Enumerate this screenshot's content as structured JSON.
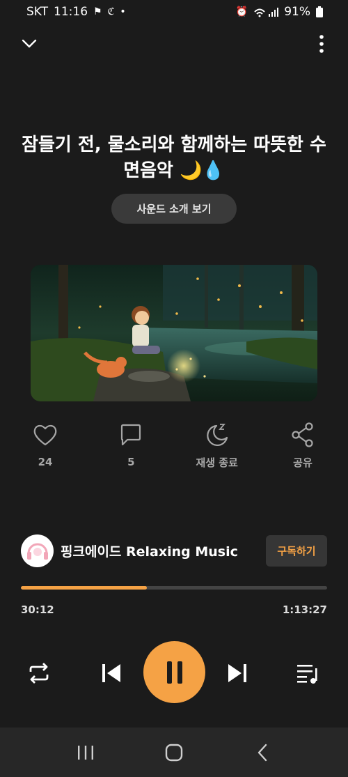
{
  "status_bar": {
    "carrier": "SKT",
    "time": "11:16",
    "battery": "91%"
  },
  "track": {
    "title": "잠들기 전, 물소리와 함께하는 따뜻한 수면음악 🌙💧",
    "intro_label": "사운드 소개 보기"
  },
  "actions": {
    "like_count": "24",
    "comment_count": "5",
    "sleep_timer_label": "재생 종료",
    "share_label": "공유"
  },
  "channel": {
    "name": "핑크에이드 Relaxing Music",
    "subscribe_label": "구독하기"
  },
  "playback": {
    "current_time": "30:12",
    "total_time": "1:13:27",
    "progress_fraction": 0.411,
    "state": "playing"
  },
  "colors": {
    "accent": "#f5a245",
    "background": "#1b1b1b",
    "button_bg": "#3a3a3a",
    "muted_icon": "#a6a6a6"
  },
  "icons": {
    "collapse": "chevron-down-icon",
    "more": "more-vertical-icon",
    "like": "heart-icon",
    "comment": "comment-icon",
    "sleep": "moon-zz-icon",
    "share": "share-icon",
    "repeat": "repeat-icon",
    "previous": "skip-previous-icon",
    "pause": "pause-icon",
    "next": "skip-next-icon",
    "queue": "playlist-icon"
  }
}
